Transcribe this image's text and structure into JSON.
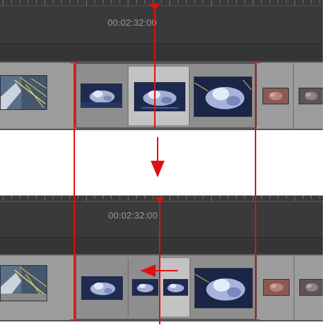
{
  "top": {
    "timecode": "00:02:32:00"
  },
  "bottom": {
    "timecode": "00:02:32:00"
  },
  "colors": {
    "marker": "#e01010",
    "panel": "#3f3f3f",
    "track": "#9c9c9c"
  },
  "icons": {
    "arrow_down": "arrow-down-icon",
    "arrow_left": "arrow-left-icon",
    "playhead": "playhead-marker-icon"
  }
}
